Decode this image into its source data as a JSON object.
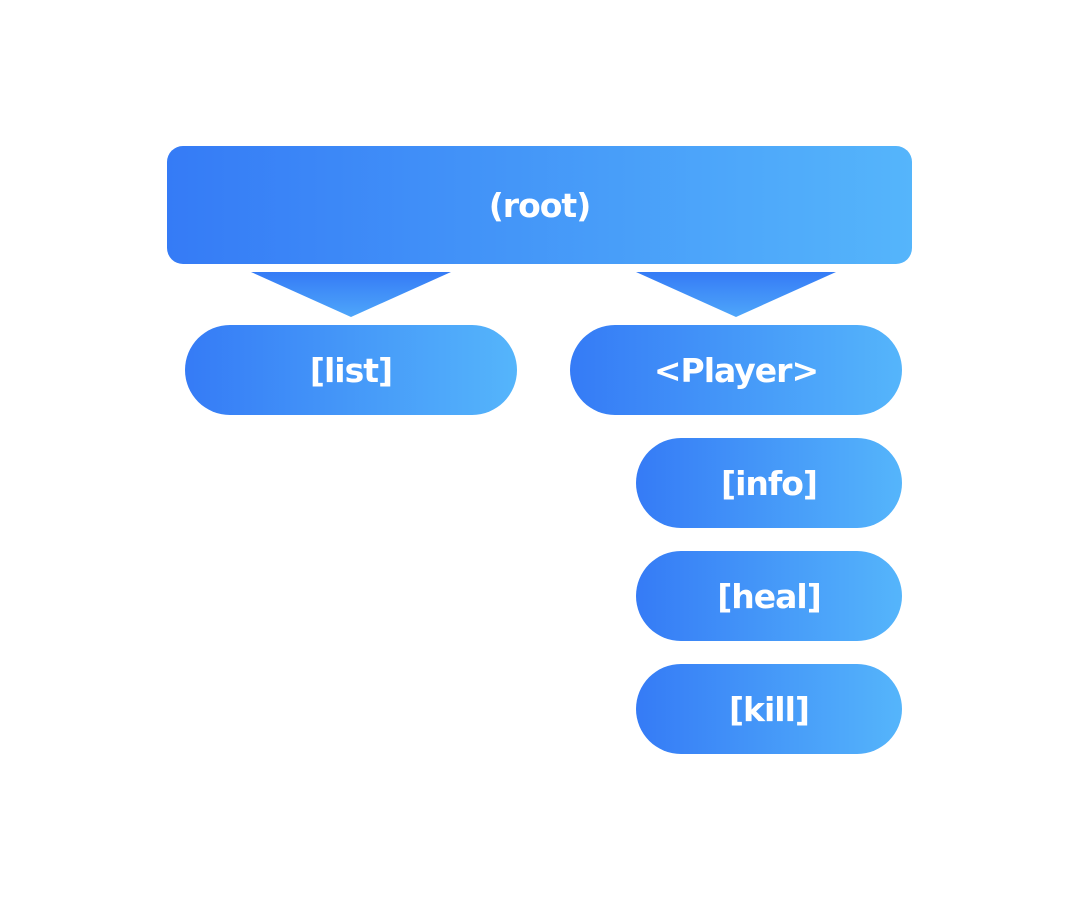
{
  "diagram": {
    "colors": {
      "gradient_start": "#357bf6",
      "gradient_end": "#55b5fb",
      "text": "#ffffff"
    },
    "root": {
      "label": "(root)"
    },
    "children": [
      {
        "label": "[list]"
      },
      {
        "label": "<Player>",
        "subcommands": [
          {
            "label": "[info]"
          },
          {
            "label": "[heal]"
          },
          {
            "label": "[kill]"
          }
        ]
      }
    ]
  }
}
